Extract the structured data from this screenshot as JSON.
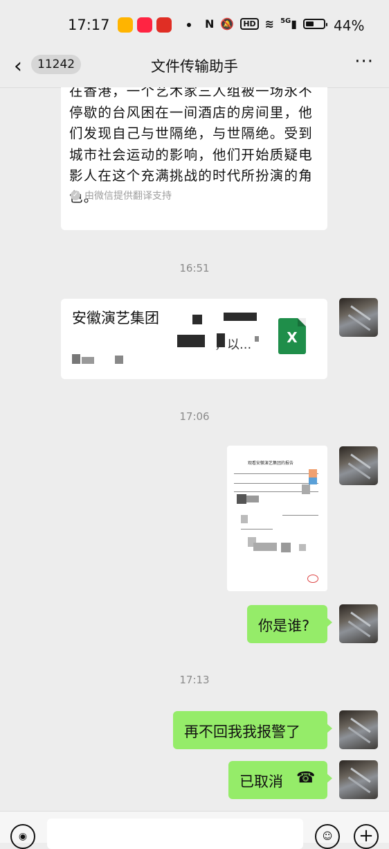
{
  "status_bar": {
    "time": "17:17",
    "battery": "44%",
    "network": "5G",
    "hd": "HD"
  },
  "header": {
    "back_count": "11242",
    "title": "文件传输助手",
    "more": "···"
  },
  "messages": {
    "translation": {
      "text": "在香港，一个艺术家三人组被一场永不停歇的台风困在一间酒店的房间里，他们发现自己与世隔绝，与世隔绝。受到城市社会运动的影响，他们开始质疑电影人在这个充满挑战的时代所扮演的角色。",
      "support": "由微信提供翻译支持"
    },
    "ts1": "16:51",
    "file": {
      "name": "安徽演艺集团",
      "name_suffix": "，以...",
      "icon_letter": "X"
    },
    "ts2": "17:06",
    "image_title": "观看安徽演艺集团的报告",
    "msg1": "你是谁?",
    "ts3": "17:13",
    "msg2": "再不回我我报警了",
    "msg3": "已取消"
  },
  "colors": {
    "background": "#ededed",
    "sent_bubble": "#95ec69",
    "received_bubble": "#ffffff",
    "excel_green": "#1f8e4a"
  }
}
